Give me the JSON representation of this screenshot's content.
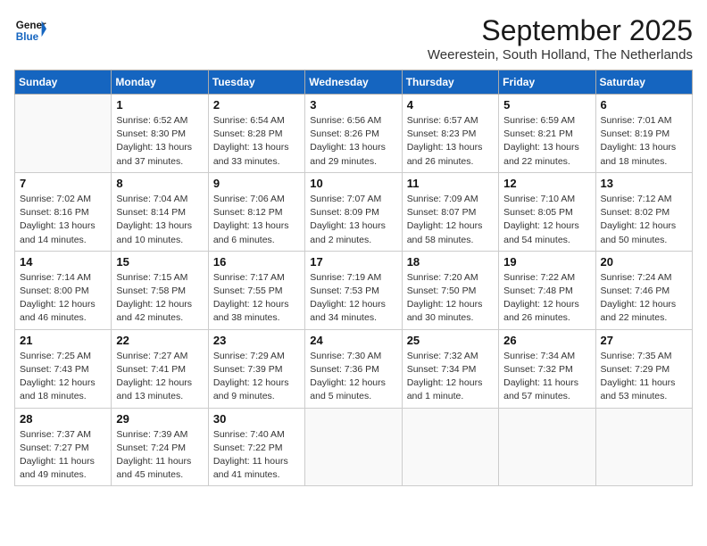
{
  "header": {
    "logo_line1": "General",
    "logo_line2": "Blue",
    "month": "September 2025",
    "location": "Weerestein, South Holland, The Netherlands"
  },
  "weekdays": [
    "Sunday",
    "Monday",
    "Tuesday",
    "Wednesday",
    "Thursday",
    "Friday",
    "Saturday"
  ],
  "weeks": [
    [
      {
        "day": "",
        "info": ""
      },
      {
        "day": "1",
        "info": "Sunrise: 6:52 AM\nSunset: 8:30 PM\nDaylight: 13 hours\nand 37 minutes."
      },
      {
        "day": "2",
        "info": "Sunrise: 6:54 AM\nSunset: 8:28 PM\nDaylight: 13 hours\nand 33 minutes."
      },
      {
        "day": "3",
        "info": "Sunrise: 6:56 AM\nSunset: 8:26 PM\nDaylight: 13 hours\nand 29 minutes."
      },
      {
        "day": "4",
        "info": "Sunrise: 6:57 AM\nSunset: 8:23 PM\nDaylight: 13 hours\nand 26 minutes."
      },
      {
        "day": "5",
        "info": "Sunrise: 6:59 AM\nSunset: 8:21 PM\nDaylight: 13 hours\nand 22 minutes."
      },
      {
        "day": "6",
        "info": "Sunrise: 7:01 AM\nSunset: 8:19 PM\nDaylight: 13 hours\nand 18 minutes."
      }
    ],
    [
      {
        "day": "7",
        "info": "Sunrise: 7:02 AM\nSunset: 8:16 PM\nDaylight: 13 hours\nand 14 minutes."
      },
      {
        "day": "8",
        "info": "Sunrise: 7:04 AM\nSunset: 8:14 PM\nDaylight: 13 hours\nand 10 minutes."
      },
      {
        "day": "9",
        "info": "Sunrise: 7:06 AM\nSunset: 8:12 PM\nDaylight: 13 hours\nand 6 minutes."
      },
      {
        "day": "10",
        "info": "Sunrise: 7:07 AM\nSunset: 8:09 PM\nDaylight: 13 hours\nand 2 minutes."
      },
      {
        "day": "11",
        "info": "Sunrise: 7:09 AM\nSunset: 8:07 PM\nDaylight: 12 hours\nand 58 minutes."
      },
      {
        "day": "12",
        "info": "Sunrise: 7:10 AM\nSunset: 8:05 PM\nDaylight: 12 hours\nand 54 minutes."
      },
      {
        "day": "13",
        "info": "Sunrise: 7:12 AM\nSunset: 8:02 PM\nDaylight: 12 hours\nand 50 minutes."
      }
    ],
    [
      {
        "day": "14",
        "info": "Sunrise: 7:14 AM\nSunset: 8:00 PM\nDaylight: 12 hours\nand 46 minutes."
      },
      {
        "day": "15",
        "info": "Sunrise: 7:15 AM\nSunset: 7:58 PM\nDaylight: 12 hours\nand 42 minutes."
      },
      {
        "day": "16",
        "info": "Sunrise: 7:17 AM\nSunset: 7:55 PM\nDaylight: 12 hours\nand 38 minutes."
      },
      {
        "day": "17",
        "info": "Sunrise: 7:19 AM\nSunset: 7:53 PM\nDaylight: 12 hours\nand 34 minutes."
      },
      {
        "day": "18",
        "info": "Sunrise: 7:20 AM\nSunset: 7:50 PM\nDaylight: 12 hours\nand 30 minutes."
      },
      {
        "day": "19",
        "info": "Sunrise: 7:22 AM\nSunset: 7:48 PM\nDaylight: 12 hours\nand 26 minutes."
      },
      {
        "day": "20",
        "info": "Sunrise: 7:24 AM\nSunset: 7:46 PM\nDaylight: 12 hours\nand 22 minutes."
      }
    ],
    [
      {
        "day": "21",
        "info": "Sunrise: 7:25 AM\nSunset: 7:43 PM\nDaylight: 12 hours\nand 18 minutes."
      },
      {
        "day": "22",
        "info": "Sunrise: 7:27 AM\nSunset: 7:41 PM\nDaylight: 12 hours\nand 13 minutes."
      },
      {
        "day": "23",
        "info": "Sunrise: 7:29 AM\nSunset: 7:39 PM\nDaylight: 12 hours\nand 9 minutes."
      },
      {
        "day": "24",
        "info": "Sunrise: 7:30 AM\nSunset: 7:36 PM\nDaylight: 12 hours\nand 5 minutes."
      },
      {
        "day": "25",
        "info": "Sunrise: 7:32 AM\nSunset: 7:34 PM\nDaylight: 12 hours\nand 1 minute."
      },
      {
        "day": "26",
        "info": "Sunrise: 7:34 AM\nSunset: 7:32 PM\nDaylight: 11 hours\nand 57 minutes."
      },
      {
        "day": "27",
        "info": "Sunrise: 7:35 AM\nSunset: 7:29 PM\nDaylight: 11 hours\nand 53 minutes."
      }
    ],
    [
      {
        "day": "28",
        "info": "Sunrise: 7:37 AM\nSunset: 7:27 PM\nDaylight: 11 hours\nand 49 minutes."
      },
      {
        "day": "29",
        "info": "Sunrise: 7:39 AM\nSunset: 7:24 PM\nDaylight: 11 hours\nand 45 minutes."
      },
      {
        "day": "30",
        "info": "Sunrise: 7:40 AM\nSunset: 7:22 PM\nDaylight: 11 hours\nand 41 minutes."
      },
      {
        "day": "",
        "info": ""
      },
      {
        "day": "",
        "info": ""
      },
      {
        "day": "",
        "info": ""
      },
      {
        "day": "",
        "info": ""
      }
    ]
  ]
}
